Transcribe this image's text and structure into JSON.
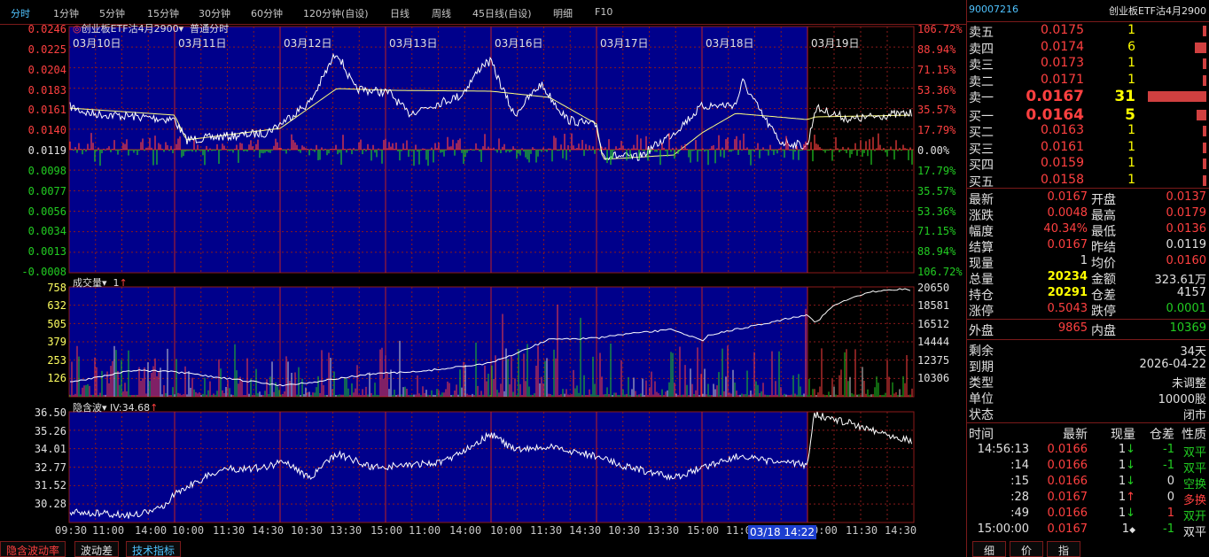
{
  "toolbar": {
    "tabs": [
      "分时",
      "1分钟",
      "5分钟",
      "15分钟",
      "30分钟",
      "60分钟",
      "120分钟(自设)",
      "日线",
      "周线",
      "45日线(自设)",
      "明细",
      "F10"
    ]
  },
  "price_pane": {
    "title": "创业板ETF沽4月2900",
    "mode": "普通分时",
    "dates": [
      "03月10日",
      "03月11日",
      "03月12日",
      "03月13日",
      "03月16日",
      "03月17日",
      "03月18日",
      "03月19日"
    ],
    "left_axis": [
      "0.0246",
      "0.0225",
      "0.0204",
      "0.0183",
      "0.0161",
      "0.0140",
      "0.0119",
      "0.0098",
      "0.0077",
      "0.0056",
      "0.0034",
      "0.0013",
      "-0.0008"
    ],
    "right_axis": [
      "106.72%",
      "88.94%",
      "71.15%",
      "53.36%",
      "35.57%",
      "17.79%",
      "0.00%",
      "17.79%",
      "35.57%",
      "53.36%",
      "71.15%",
      "88.94%",
      "106.72%"
    ]
  },
  "volume_pane": {
    "label": "成交量",
    "sub": "1",
    "left_axis": [
      "758",
      "632",
      "505",
      "379",
      "253",
      "126"
    ],
    "right_axis": [
      "20650",
      "18581",
      "16512",
      "14444",
      "12375",
      "10306"
    ]
  },
  "iv_pane": {
    "label": "隐含波",
    "iv_text": "IV:34.68",
    "left_axis": [
      "36.50",
      "35.26",
      "34.01",
      "32.77",
      "31.52",
      "30.28"
    ]
  },
  "time_axis": [
    "09:30",
    "11:00",
    "14:00",
    "10:00",
    "11:30",
    "14:30",
    "10:30",
    "13:30",
    "15:00",
    "11:00",
    "14:00",
    "10:00",
    "11:30",
    "14:30",
    "10:30",
    "13:30",
    "15:00",
    "11:0",
    "0:00",
    "11:30",
    "14:30"
  ],
  "cursor_time": "03/18 14:22",
  "bottom_tabs": [
    "隐含波动率",
    "波动差",
    "技术指标"
  ],
  "right_panel": {
    "code": "90007216",
    "name": "创业板ETF沽4月2900",
    "asks": [
      {
        "label": "卖五",
        "price": "0.0175",
        "qty": "1"
      },
      {
        "label": "卖四",
        "price": "0.0174",
        "qty": "6"
      },
      {
        "label": "卖三",
        "price": "0.0173",
        "qty": "1"
      },
      {
        "label": "卖二",
        "price": "0.0171",
        "qty": "1"
      },
      {
        "label": "卖一",
        "price": "0.0167",
        "qty": "31"
      }
    ],
    "bids": [
      {
        "label": "买一",
        "price": "0.0164",
        "qty": "5"
      },
      {
        "label": "买二",
        "price": "0.0163",
        "qty": "1"
      },
      {
        "label": "买三",
        "price": "0.0161",
        "qty": "1"
      },
      {
        "label": "买四",
        "price": "0.0159",
        "qty": "1"
      },
      {
        "label": "买五",
        "price": "0.0158",
        "qty": "1"
      }
    ],
    "stats": [
      {
        "l1": "最新",
        "v1": "0.0167",
        "c1": "red",
        "l2": "开盘",
        "v2": "0.0137",
        "c2": "red"
      },
      {
        "l1": "涨跌",
        "v1": "0.0048",
        "c1": "red",
        "l2": "最高",
        "v2": "0.0179",
        "c2": "red"
      },
      {
        "l1": "幅度",
        "v1": "40.34%",
        "c1": "red",
        "l2": "最低",
        "v2": "0.0136",
        "c2": "red"
      },
      {
        "l1": "结算",
        "v1": "0.0167",
        "c1": "red",
        "l2": "昨结",
        "v2": "0.0119",
        "c2": "white"
      },
      {
        "l1": "现量",
        "v1": "1",
        "c1": "white",
        "l2": "均价",
        "v2": "0.0160",
        "c2": "red"
      },
      {
        "l1": "总量",
        "v1": "20234",
        "c1": "yellow",
        "l2": "金额",
        "v2": "323.61万",
        "c2": "white"
      },
      {
        "l1": "持仓",
        "v1": "20291",
        "c1": "yellow",
        "l2": "仓差",
        "v2": "4157",
        "c2": "white"
      },
      {
        "l1": "涨停",
        "v1": "0.5043",
        "c1": "red",
        "l2": "跌停",
        "v2": "0.0001",
        "c2": "green"
      }
    ],
    "outer_label": "外盘",
    "outer_value": "9865",
    "inner_label": "内盘",
    "inner_value": "10369",
    "info": [
      {
        "label": "剩余",
        "value": "34天"
      },
      {
        "label": "到期",
        "value": "2026-04-22"
      },
      {
        "label": "类型",
        "value": "未调整"
      },
      {
        "label": "单位",
        "value": "10000股"
      },
      {
        "label": "状态",
        "value": "闭市"
      }
    ],
    "trade_headers": [
      "时间",
      "最新",
      "现量",
      "仓差",
      "性质"
    ],
    "trades": [
      {
        "time": "14:56:13",
        "price": "0.0166",
        "qty": "1",
        "dir": "down",
        "diff": "-1",
        "nature": "双平",
        "ncol": "green"
      },
      {
        "time": ":14",
        "price": "0.0166",
        "qty": "1",
        "dir": "down",
        "diff": "-1",
        "nature": "双平",
        "ncol": "green"
      },
      {
        "time": ":15",
        "price": "0.0166",
        "qty": "1",
        "dir": "down",
        "diff": "0",
        "nature": "空换",
        "ncol": "green"
      },
      {
        "time": ":28",
        "price": "0.0167",
        "qty": "1",
        "dir": "up",
        "diff": "0",
        "nature": "多换",
        "ncol": "red"
      },
      {
        "time": ":49",
        "price": "0.0166",
        "qty": "1",
        "dir": "down",
        "diff": "1",
        "nature": "双开",
        "ncol": "green"
      },
      {
        "time": "15:00:00",
        "price": "0.0167",
        "qty": "1",
        "dir": "flat",
        "diff": "-1",
        "nature": "双平",
        "ncol": "white"
      }
    ],
    "bottom_tabs": [
      "细",
      "价",
      "指"
    ]
  },
  "colors": {
    "up": "#ff4040",
    "down": "#22cc22",
    "panel_bg": "#00008b",
    "grid": "#8b1a1a",
    "line": "#ffffff",
    "avg": "#ffff80"
  }
}
